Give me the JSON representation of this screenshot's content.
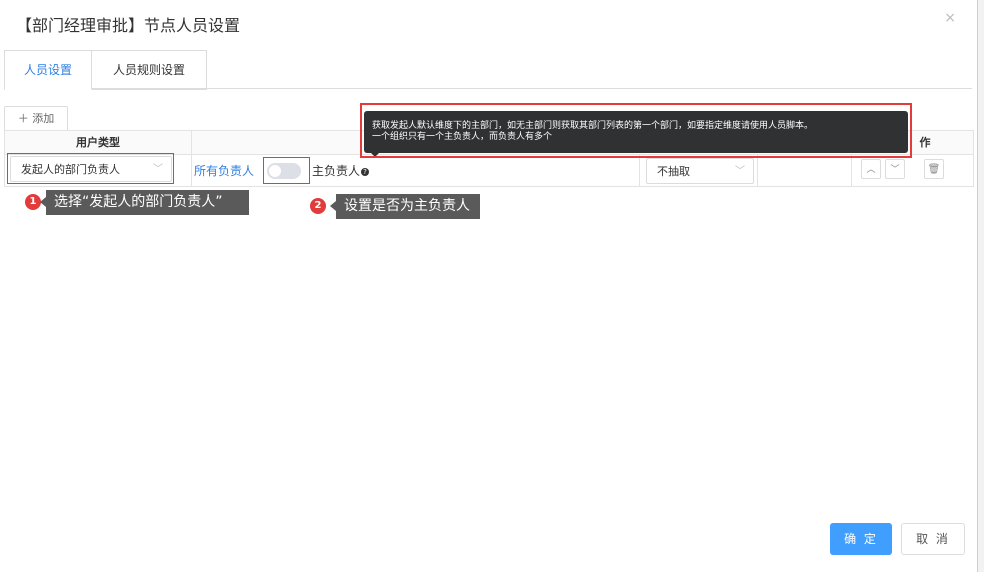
{
  "dialog": {
    "title": "【部门经理审批】节点人员设置",
    "close_glyph": "×"
  },
  "tabs": [
    {
      "label": "人员设置",
      "active": true
    },
    {
      "label": "人员规则设置",
      "active": false
    }
  ],
  "toolbar": {
    "add_label": "＋ 添加"
  },
  "table": {
    "headers": {
      "user_type": "用户类型",
      "operation_partial": "作"
    },
    "row": {
      "user_type_value": "发起人的部门负责人",
      "all_leaders_link": "所有负责人",
      "main_leader_label": "主负责人",
      "main_leader_toggle_on": false,
      "extract_value": "不抽取"
    }
  },
  "tooltip": {
    "line1": "获取发起人默认维度下的主部门，如无主部门则获取其部门列表的第一个部门，如要指定维度请使用人员脚本。",
    "line2": "一个组织只有一个主负责人，而负责人有多个"
  },
  "annotations": [
    {
      "number": "1",
      "text": "选择“发起人的部门负责人”"
    },
    {
      "number": "2",
      "text": "设置是否为主负责人"
    }
  ],
  "footer": {
    "ok_label": "确 定",
    "cancel_label": "取 消"
  },
  "colors": {
    "accent": "#409eff",
    "link": "#2f7fe0",
    "highlight_red": "#e23b3b",
    "tooltip_bg": "#303133",
    "callout_bg": "#5a5a5a"
  }
}
